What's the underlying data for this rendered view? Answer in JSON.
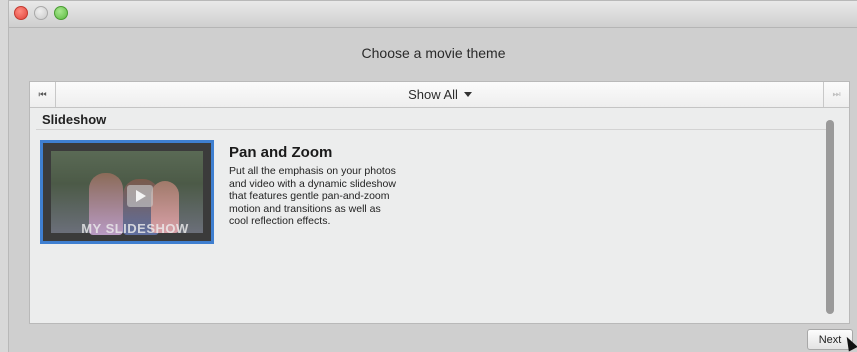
{
  "window": {
    "controls": {
      "close": "close-icon",
      "minimize": "minimize-icon",
      "zoom": "zoom-icon"
    },
    "title": "Choose a movie theme"
  },
  "toolbar": {
    "prev_icon": "⏮",
    "next_icon": "⏭",
    "filter_label": "Show All"
  },
  "section": {
    "header": "Slideshow"
  },
  "theme": {
    "title": "Pan and Zoom",
    "description": "Put all the emphasis on your photos and video with a dynamic slideshow that features gentle pan-and-zoom motion and transitions as well as cool reflection effects.",
    "thumbnail_caption": "MY SLIDESHOW",
    "selected_border_color": "#3f7fd0"
  },
  "footer": {
    "next_label": "Next"
  }
}
